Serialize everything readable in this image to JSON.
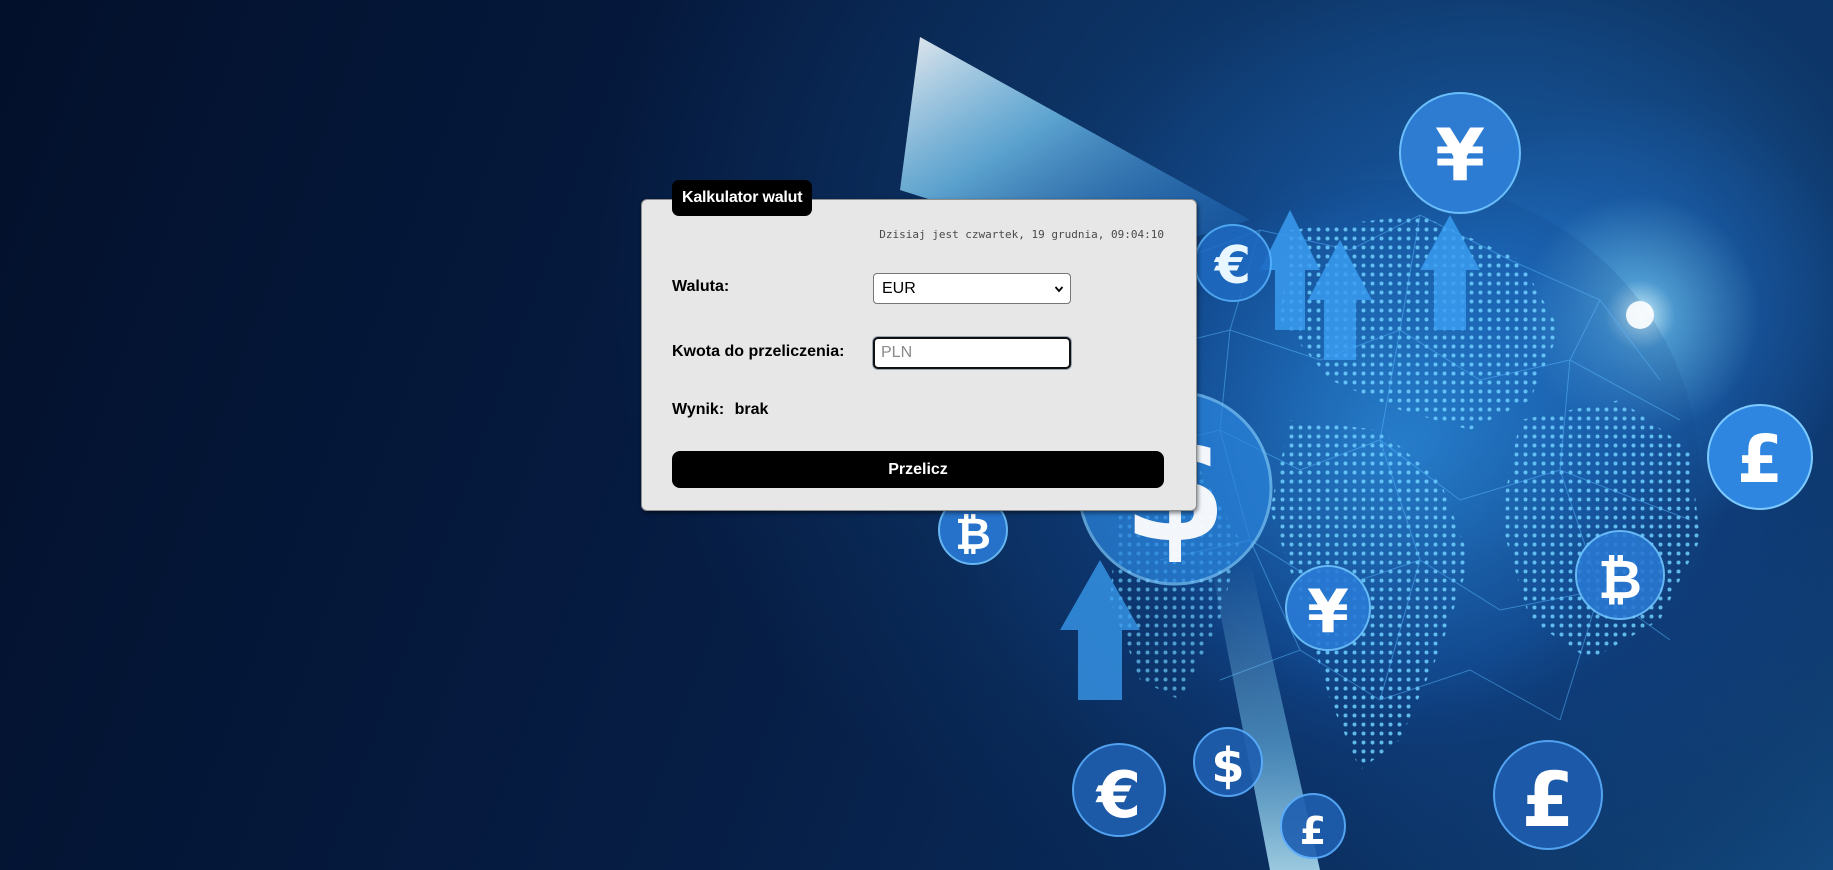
{
  "background": {
    "currency_symbols": [
      "¥",
      "€",
      "$",
      "£",
      "₿",
      "¥",
      "€",
      "₿",
      "$",
      "₿",
      "£",
      "£"
    ]
  },
  "calculator": {
    "title": "Kalkulator walut",
    "date_text": "Dzisiaj jest czwartek, 19 grudnia, 09:04:10",
    "currency_label": "Waluta:",
    "currency_selected": "EUR",
    "amount_label": "Kwota do przeliczenia:",
    "amount_placeholder": "PLN",
    "result_label": "Wynik:",
    "result_value": "brak",
    "convert_button": "Przelicz"
  }
}
